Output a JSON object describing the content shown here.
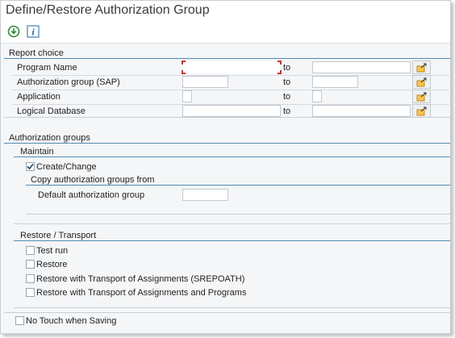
{
  "window": {
    "title": "Define/Restore Authorization Group"
  },
  "toolbar": {
    "execute_icon": "execute-icon",
    "info_icon": "info-icon"
  },
  "report_choice": {
    "title": "Report choice",
    "to_label": "to",
    "rows": [
      {
        "label": "Program Name",
        "from_value": "",
        "to_value": ""
      },
      {
        "label": "Authorization group (SAP)",
        "from_value": "",
        "to_value": ""
      },
      {
        "label": "Application",
        "from_value": "",
        "to_value": ""
      },
      {
        "label": "Logical Database",
        "from_value": "",
        "to_value": ""
      }
    ]
  },
  "authorization_groups": {
    "title": "Authorization groups",
    "maintain": {
      "title": "Maintain",
      "create_change": {
        "label": "Create/Change",
        "checked": true
      },
      "copy_title": "Copy authorization groups from",
      "default_group": {
        "label": "Default authorization group",
        "value": ""
      }
    },
    "restore_transport": {
      "title": "Restore / Transport",
      "options": [
        {
          "label": "Test run",
          "checked": false
        },
        {
          "label": "Restore",
          "checked": false
        },
        {
          "label": "Restore with Transport of Assignments (SREPOATH)",
          "checked": false
        },
        {
          "label": "Restore with Transport of Assignments and Programs",
          "checked": false
        }
      ]
    }
  },
  "no_touch": {
    "label": "No Touch when Saving",
    "checked": false
  },
  "colors": {
    "section_line": "#4f8cb3",
    "focus": "#c0392b",
    "multi_icon": "#e6a23c"
  }
}
